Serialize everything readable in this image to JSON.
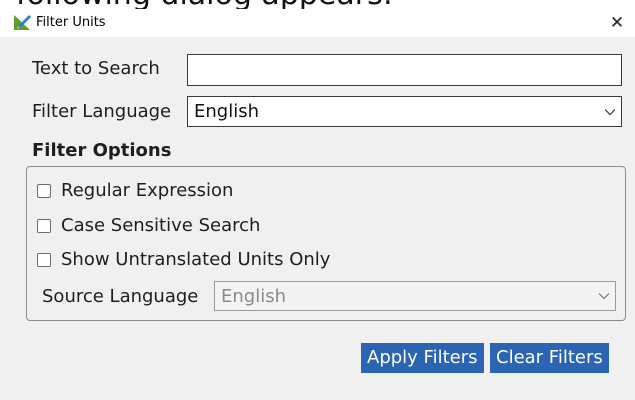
{
  "background_text": "following dialog appears:",
  "window": {
    "title": "Filter Units",
    "close_glyph": "✕"
  },
  "form": {
    "search": {
      "label": "Text to Search",
      "value": "",
      "placeholder": ""
    },
    "filter_language": {
      "label": "Filter Language",
      "value": "English"
    }
  },
  "filter_options": {
    "title": "Filter Options",
    "options": [
      {
        "label": "Regular Expression",
        "checked": false
      },
      {
        "label": "Case Sensitive Search",
        "checked": false
      },
      {
        "label": "Show Untranslated Units Only",
        "checked": false
      }
    ],
    "source_language": {
      "label": "Source Language",
      "value": "English",
      "disabled": true
    }
  },
  "buttons": {
    "apply": "Apply Filters",
    "clear": "Clear Filters"
  },
  "colors": {
    "button_bg": "#2a64b3",
    "dialog_bg": "#f0f0f0"
  }
}
